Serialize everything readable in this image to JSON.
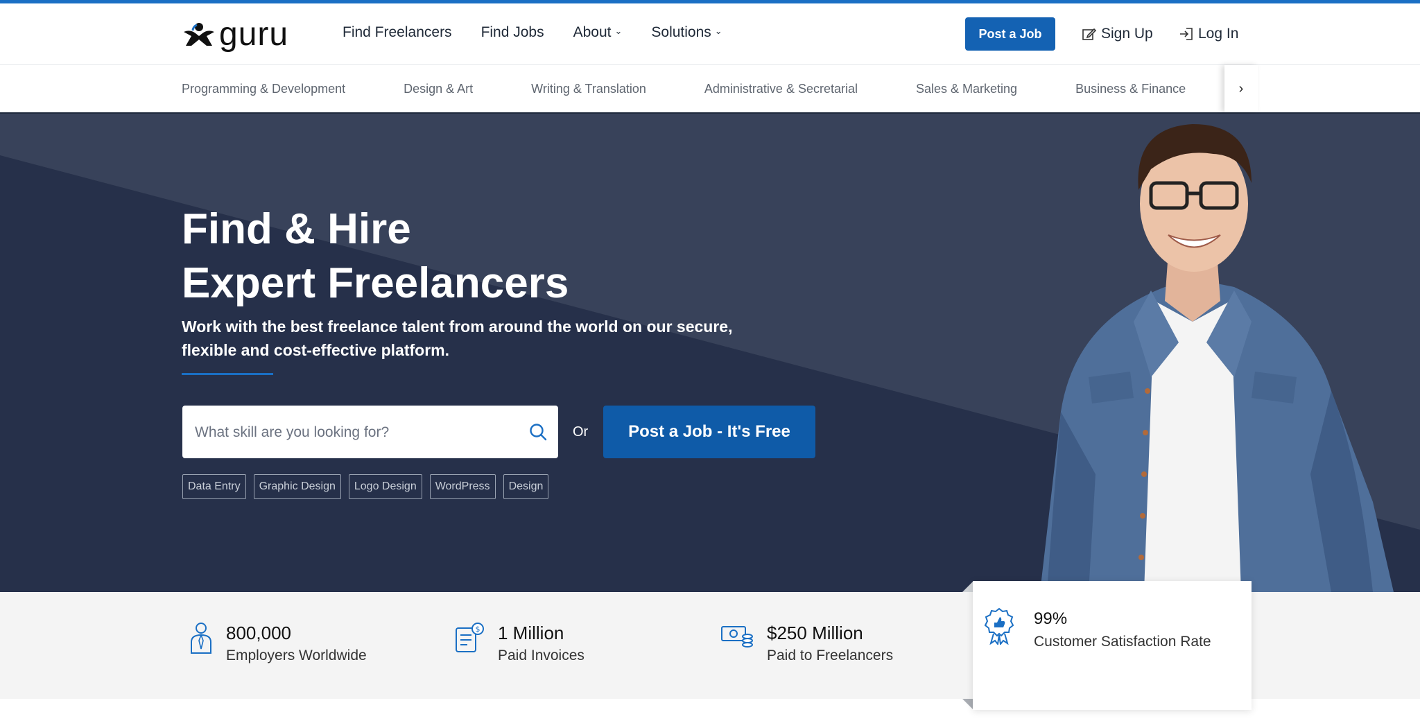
{
  "brand": {
    "name": "guru",
    "accent": "#1a6fc4",
    "button_blue": "#1462b3",
    "hero_bg": "#2c3548"
  },
  "header": {
    "nav": [
      {
        "label": "Find Freelancers",
        "dropdown": false
      },
      {
        "label": "Find Jobs",
        "dropdown": false
      },
      {
        "label": "About",
        "dropdown": true
      },
      {
        "label": "Solutions",
        "dropdown": true
      }
    ],
    "post_job_label": "Post a Job",
    "sign_up_label": "Sign Up",
    "log_in_label": "Log In"
  },
  "categories": [
    "Programming & Development",
    "Design & Art",
    "Writing & Translation",
    "Administrative & Secretarial",
    "Sales & Marketing",
    "Business & Finance"
  ],
  "hero": {
    "title_line1": "Find & Hire",
    "title_line2": "Expert Freelancers",
    "subtitle": "Work with the best freelance talent from around the world on our secure, flexible and cost-effective platform.",
    "search_placeholder": "What skill are you looking for?",
    "or_label": "Or",
    "post_job_free_label": "Post a Job - It's Free",
    "tags": [
      "Data Entry",
      "Graphic Design",
      "Logo Design",
      "WordPress",
      "Design"
    ]
  },
  "stats": [
    {
      "value": "800,000",
      "label": "Employers Worldwide",
      "icon": "employer-icon"
    },
    {
      "value": "1 Million",
      "label": "Paid Invoices",
      "icon": "invoice-icon"
    },
    {
      "value": "$250 Million",
      "label": "Paid to Freelancers",
      "icon": "money-icon"
    },
    {
      "value": "99%",
      "label": "Customer Satisfaction Rate",
      "icon": "award-ribbon-icon"
    }
  ]
}
